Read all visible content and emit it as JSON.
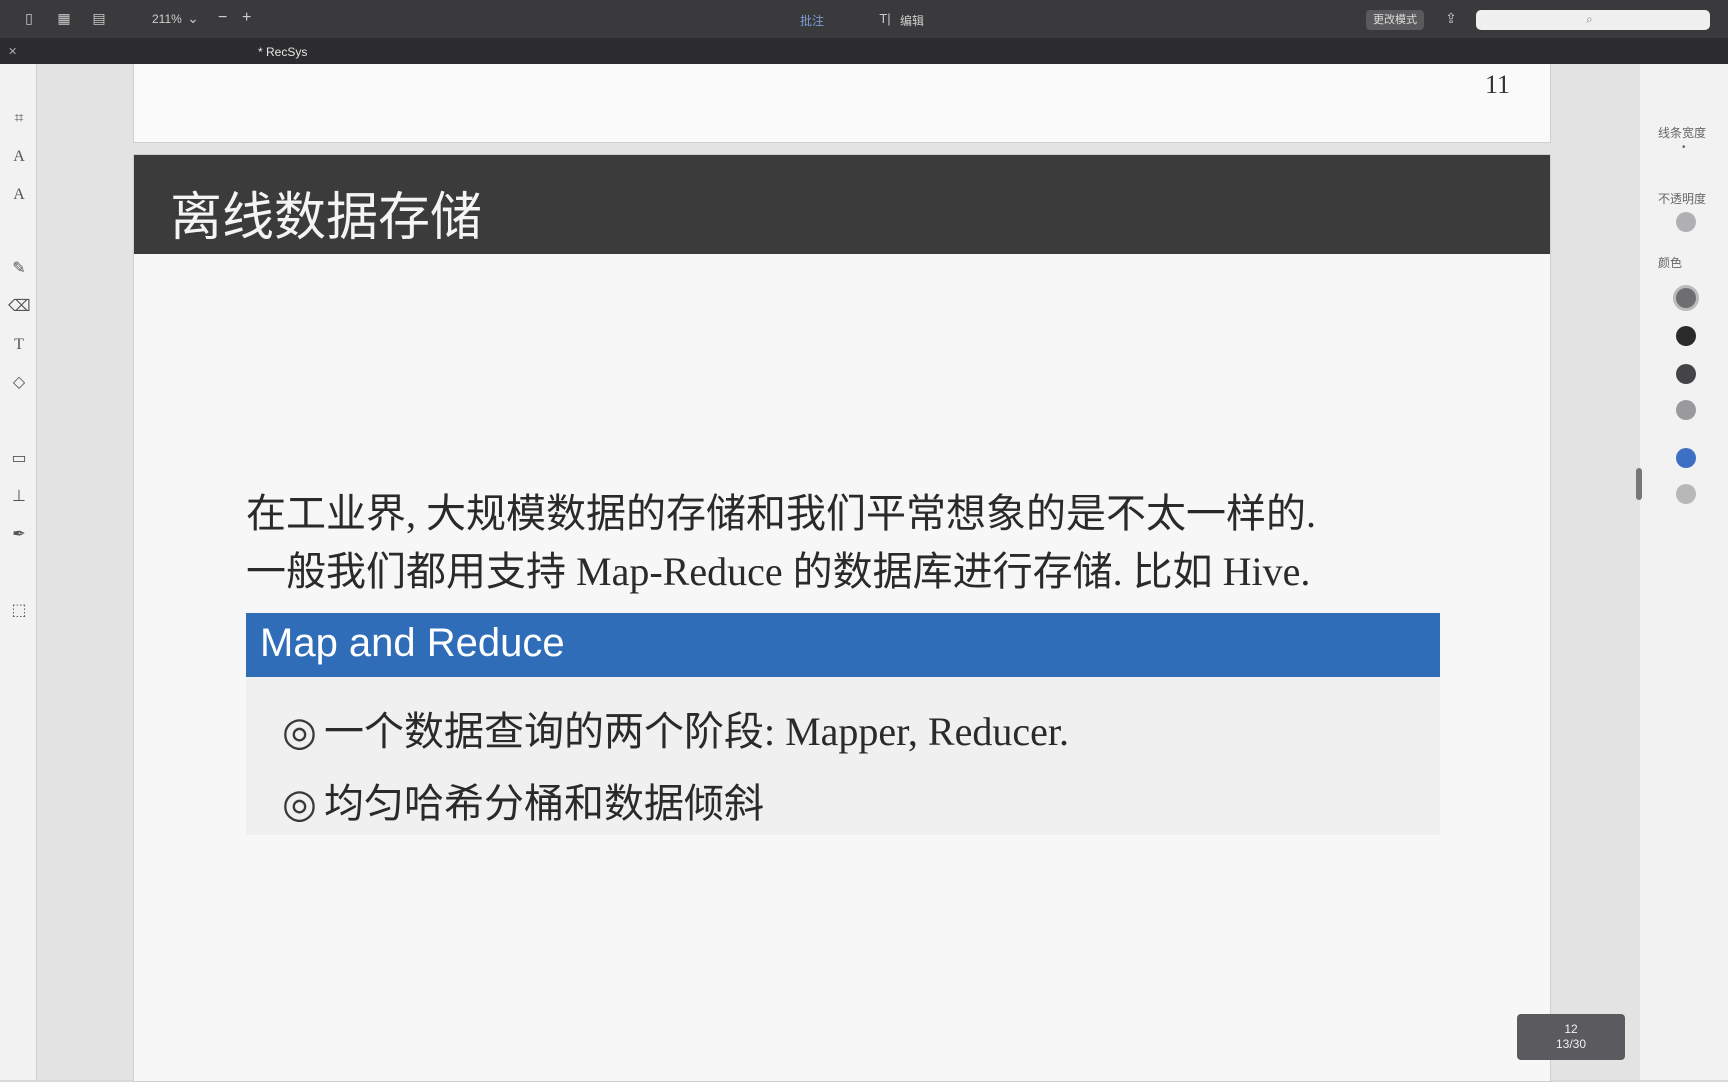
{
  "toolbar": {
    "zoom": "211%",
    "zoom_out": "−",
    "zoom_in": "+",
    "annotate_label": "批注",
    "edit_label": "编辑",
    "mode_label": "更改模式"
  },
  "tab": {
    "title": "* RecSys"
  },
  "right_panel": {
    "line_width_label": "线条宽度",
    "opacity_label": "不透明度",
    "color_label": "颜色",
    "colors": [
      "#6e6e72",
      "#2a2a2a",
      "#444448",
      "#9a9a9e",
      "#3d6fc4",
      "#b8b8b8"
    ]
  },
  "pages": {
    "prev_page_number": "11",
    "slide_title": "离线数据存储",
    "para_line1": "在工业界, 大规模数据的存储和我们平常想象的是不太一样的.",
    "para_line2": "一般我们都用支持 Map-Reduce 的数据库进行存储. 比如 Hive.",
    "block_title": "Map and Reduce",
    "bullets": [
      "一个数据查询的两个阶段: Mapper, Reducer.",
      "均匀哈希分桶和数据倾斜"
    ],
    "bullet_mark": "◎"
  },
  "page_counter": {
    "current": "12",
    "position": "13/30"
  },
  "accent_colors": {
    "title_bar": "#3b3b3b",
    "block_head": "#2f6db8"
  }
}
